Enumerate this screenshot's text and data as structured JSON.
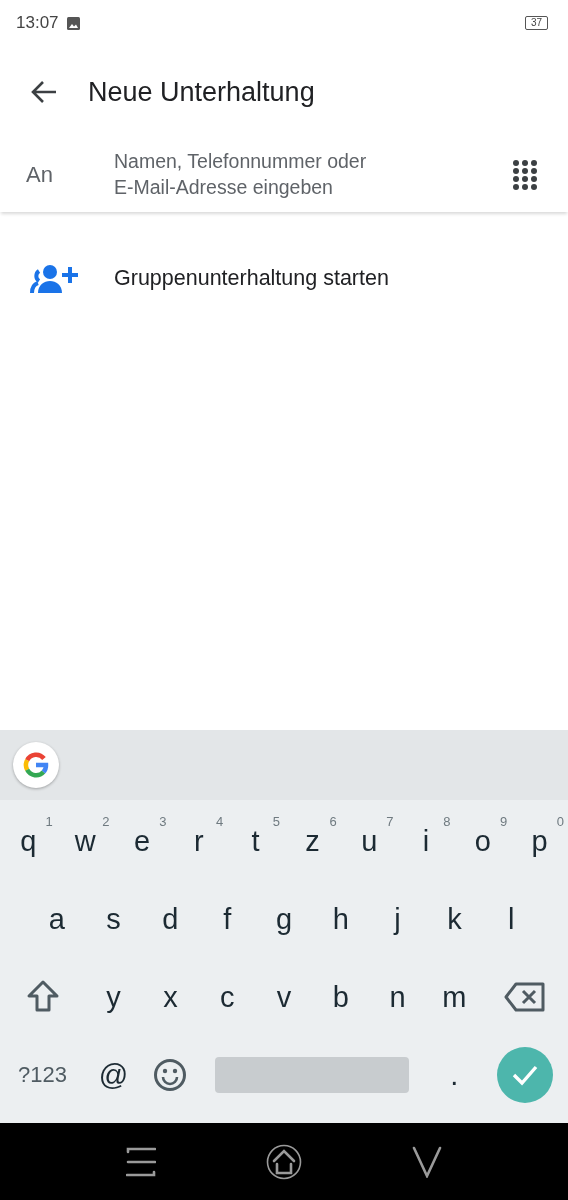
{
  "status_bar": {
    "time": "13:07",
    "battery": "37"
  },
  "header": {
    "title": "Neue Unterhaltung"
  },
  "recipient": {
    "label": "An",
    "placeholder": "Namen, Telefonnummer oder\nE-Mail-Adresse eingeben"
  },
  "actions": [
    {
      "label": "Gruppenunterhaltung starten"
    }
  ],
  "keyboard": {
    "rows": [
      {
        "keys": [
          {
            "kind": "letter",
            "label": "q",
            "hint": "1"
          },
          {
            "kind": "letter",
            "label": "w",
            "hint": "2"
          },
          {
            "kind": "letter",
            "label": "e",
            "hint": "3"
          },
          {
            "kind": "letter",
            "label": "r",
            "hint": "4"
          },
          {
            "kind": "letter",
            "label": "t",
            "hint": "5"
          },
          {
            "kind": "letter",
            "label": "z",
            "hint": "6"
          },
          {
            "kind": "letter",
            "label": "u",
            "hint": "7"
          },
          {
            "kind": "letter",
            "label": "i",
            "hint": "8"
          },
          {
            "kind": "letter",
            "label": "o",
            "hint": "9"
          },
          {
            "kind": "letter",
            "label": "p",
            "hint": "0"
          }
        ]
      },
      {
        "keys": [
          {
            "kind": "letter",
            "label": "a"
          },
          {
            "kind": "letter",
            "label": "s"
          },
          {
            "kind": "letter",
            "label": "d"
          },
          {
            "kind": "letter",
            "label": "f"
          },
          {
            "kind": "letter",
            "label": "g"
          },
          {
            "kind": "letter",
            "label": "h"
          },
          {
            "kind": "letter",
            "label": "j"
          },
          {
            "kind": "letter",
            "label": "k"
          },
          {
            "kind": "letter",
            "label": "l"
          }
        ]
      },
      {
        "keys": [
          {
            "kind": "shift"
          },
          {
            "kind": "letter",
            "label": "y"
          },
          {
            "kind": "letter",
            "label": "x"
          },
          {
            "kind": "letter",
            "label": "c"
          },
          {
            "kind": "letter",
            "label": "v"
          },
          {
            "kind": "letter",
            "label": "b"
          },
          {
            "kind": "letter",
            "label": "n"
          },
          {
            "kind": "letter",
            "label": "m"
          },
          {
            "kind": "backspace"
          }
        ]
      },
      {
        "keys": [
          {
            "kind": "symbols",
            "label": "?123"
          },
          {
            "kind": "letter",
            "label": "@"
          },
          {
            "kind": "emoji"
          },
          {
            "kind": "space"
          },
          {
            "kind": "letter",
            "label": "."
          },
          {
            "kind": "enter"
          }
        ]
      }
    ]
  }
}
